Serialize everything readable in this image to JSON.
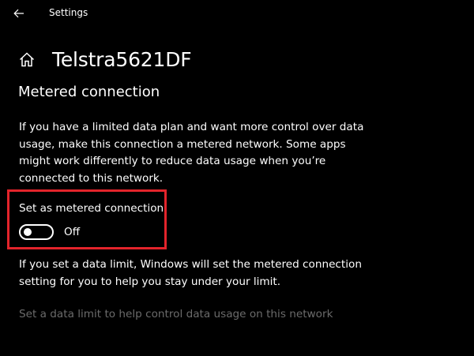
{
  "titlebar": {
    "app_title": "Settings",
    "back_icon": "back-arrow-icon"
  },
  "header": {
    "home_icon": "home-icon",
    "title": "Telstra5621DF"
  },
  "metered": {
    "section_title": "Metered connection",
    "description": "If you have a limited data plan and want more control over data usage, make this connection a metered network. Some apps might work differently to reduce data usage when you’re connected to this network.",
    "toggle_label": "Set as metered connection",
    "toggle_on": false,
    "toggle_state_text": "Off",
    "info_text": "If you set a data limit, Windows will set the metered connection setting for you to help you stay under your limit.",
    "data_limit_link": "Set a data limit to help control data usage on this network"
  },
  "colors": {
    "background": "#000000",
    "text": "#ffffff",
    "highlight": "#e3242b",
    "disabled_link": "#6b6b6b"
  }
}
